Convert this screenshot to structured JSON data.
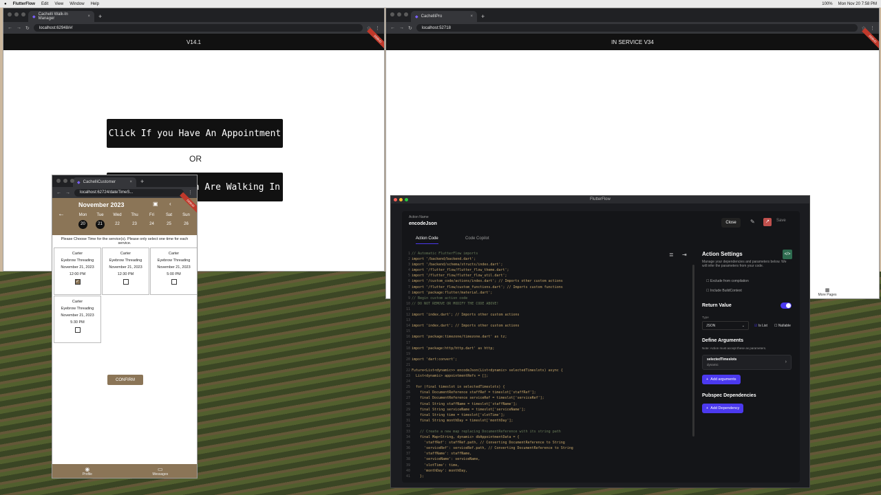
{
  "menubar": {
    "app": "FlutterFlow",
    "items": [
      "Edit",
      "View",
      "Window",
      "Help"
    ],
    "clock": "Mon Nov 20  7:58 PM",
    "battery": "100%"
  },
  "left_browser": {
    "tab": "Cachelli Walk-In Manager",
    "url": "localhost:62948/#/",
    "appbar": "V14.1",
    "appointment_button": "Click If you Have An Appointment",
    "or": "OR",
    "walkin_button": "n Are Walking In",
    "debug": "DEBUG"
  },
  "right_browser": {
    "tab": "CachelliPro",
    "url": "localhost:52718",
    "appbar": "IN SERVICE V34",
    "more_pages": "More Pages",
    "debug": "DEBUG"
  },
  "phone": {
    "tab": "CachelliCustomer",
    "url": "localhost:62724/dateTimeS...",
    "month": "November 2023",
    "days": [
      {
        "d": "Mon",
        "n": "20",
        "sel": true
      },
      {
        "d": "Tue",
        "n": "21",
        "sel": true
      },
      {
        "d": "Wed",
        "n": "22"
      },
      {
        "d": "Thu",
        "n": "23"
      },
      {
        "d": "Fri",
        "n": "24"
      },
      {
        "d": "Sat",
        "n": "25"
      },
      {
        "d": "Sun",
        "n": "26"
      }
    ],
    "instructions": "Please Choose Time for the service(s). Please only select one time for each service.",
    "slots": [
      {
        "name": "Carter",
        "service": "Eyebrow Threading",
        "date": "November 21, 2023",
        "time": "12:00 PM",
        "checked": true
      },
      {
        "name": "Carter",
        "service": "Eyebrow Threading",
        "date": "November 21, 2023",
        "time": "12:30 PM",
        "checked": false
      },
      {
        "name": "Carter",
        "service": "Eyebrow Threading",
        "date": "November 21, 2023",
        "time": "5:00 PM",
        "checked": false
      },
      {
        "name": "Carter",
        "service": "Eyebrow Threading",
        "date": "November 21, 2023",
        "time": "5:30 PM",
        "checked": false
      }
    ],
    "confirm": "CONFIRM",
    "nav": [
      "Profile",
      "Messages"
    ],
    "debug": "DEBUG"
  },
  "ff": {
    "window_title": "FlutterFlow",
    "action_name_label": "Action Name",
    "action_name": "encodeJson",
    "close": "Close",
    "save": "Save",
    "tabs": [
      "Action Code",
      "Code Copilot"
    ],
    "settings_title": "Action Settings",
    "settings_desc": "Manage your dependencies and parameters below. We will infer the parameters from your code.",
    "exclude": "Exclude from compilation",
    "include_build": "Include BuildContext",
    "return_value": "Return Value",
    "type_label": "Type",
    "type_value": "JSON",
    "is_list": "Is List",
    "nullable": "Nullable",
    "define_args": "Define Arguments",
    "args_note": "Note: Action must accept these as parameters.",
    "arg_name": "selectedTimeslots",
    "arg_type": "dynamic",
    "add_args": "Add arguments",
    "pubspec": "Pubspec Dependencies",
    "add_dep": "Add Dependency",
    "code_lines": [
      "// Automatic FlutterFlow imports",
      "import '/backend/backend.dart';",
      "import '/backend/schema/structs/index.dart';",
      "import '/flutter_flow/flutter_flow_theme.dart';",
      "import '/flutter_flow/flutter_flow_util.dart';",
      "import '/custom_code/actions/index.dart'; // Imports other custom actions",
      "import '/flutter_flow/custom_functions.dart'; // Imports custom functions",
      "import 'package:flutter/material.dart';",
      "// Begin custom action code",
      "// DO NOT REMOVE OR MODIFY THE CODE ABOVE!",
      "",
      "import 'index.dart'; // Imports other custom actions",
      "",
      "import 'index.dart'; // Imports other custom actions",
      "",
      "import 'package:timezone/timezone.dart' as tz;",
      "",
      "import 'package:http/http.dart' as http;",
      "",
      "import 'dart:convert';",
      "",
      "Future<List<dynamic>> encodeJson(List<dynamic> selectedTimeslots) async {",
      "  List<dynamic> appointmentRefs = [];",
      "",
      "  for (final timeslot in selectedTimeslots) {",
      "    final DocumentReference staffRef = timeslot['staffRef'];",
      "    final DocumentReference serviceRef = timeslot['serviceRef'];",
      "    final String staffName = timeslot['staffName'];",
      "    final String serviceName = timeslot['serviceName'];",
      "    final String time = timeslot['slotTime'];",
      "    final String monthDay = timeslot['monthDay'];",
      "",
      "    // Create a new map replacing DocumentReference with its string path",
      "    final Map<String, dynamic> dbAppointmentData = {",
      "      'staffRef': staffRef.path, // Converting DocumentReference to String",
      "      'serviceRef': serviceRef.path, // Converting DocumentReference to String",
      "      'staffName': staffName,",
      "      'serviceName': serviceName,",
      "      'slotTime': time,",
      "      'monthDay': monthDay,",
      "    };"
    ]
  }
}
